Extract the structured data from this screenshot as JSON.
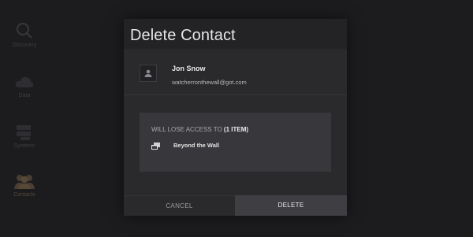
{
  "sidebar": {
    "items": [
      {
        "label": "Discovery",
        "icon": "search-icon"
      },
      {
        "label": "Data",
        "icon": "cloud-icon"
      },
      {
        "label": "Systems",
        "icon": "servers-icon"
      },
      {
        "label": "Contacts",
        "icon": "people-icon",
        "active": true
      }
    ]
  },
  "dialog": {
    "title": "Delete Contact",
    "contact": {
      "name": "Jon Snow",
      "email": "watcherronthewall@got.com",
      "avatar_icon": "person-icon"
    },
    "access": {
      "heading_prefix": "WILL LOSE ACCESS TO",
      "heading_count": "(1 ITEM)",
      "items": [
        {
          "label": "Beyond the Wall",
          "icon": "folders-icon"
        }
      ]
    },
    "buttons": {
      "cancel": "CANCEL",
      "delete": "DELETE"
    }
  },
  "colors": {
    "background": "#1c1c1e",
    "modal": "#2a2a2d",
    "access_box": "#38383c",
    "primary_button": "#3f3f43"
  }
}
